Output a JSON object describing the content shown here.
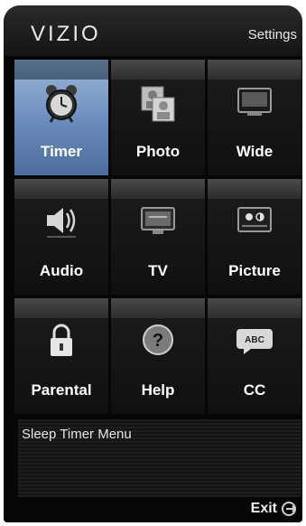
{
  "header": {
    "brand": "VIZIO",
    "title": "Settings"
  },
  "tiles": [
    {
      "label": "Timer",
      "icon": "alarm-clock-icon",
      "selected": true
    },
    {
      "label": "Photo",
      "icon": "photo-icon"
    },
    {
      "label": "Wide",
      "icon": "wide-screen-icon"
    },
    {
      "label": "Audio",
      "icon": "speaker-icon"
    },
    {
      "label": "TV",
      "icon": "tv-icon"
    },
    {
      "label": "Picture",
      "icon": "picture-settings-icon"
    },
    {
      "label": "Parental",
      "icon": "lock-icon"
    },
    {
      "label": "Help",
      "icon": "help-icon"
    },
    {
      "label": "CC",
      "icon": "closed-caption-icon"
    }
  ],
  "status": {
    "description": "Sleep Timer Menu"
  },
  "footer": {
    "exit_label": "Exit",
    "exit_icon": "exit-icon"
  },
  "colors": {
    "selected_tile": "#6e8fbd",
    "background": "#060606",
    "text": "#ffffff"
  }
}
